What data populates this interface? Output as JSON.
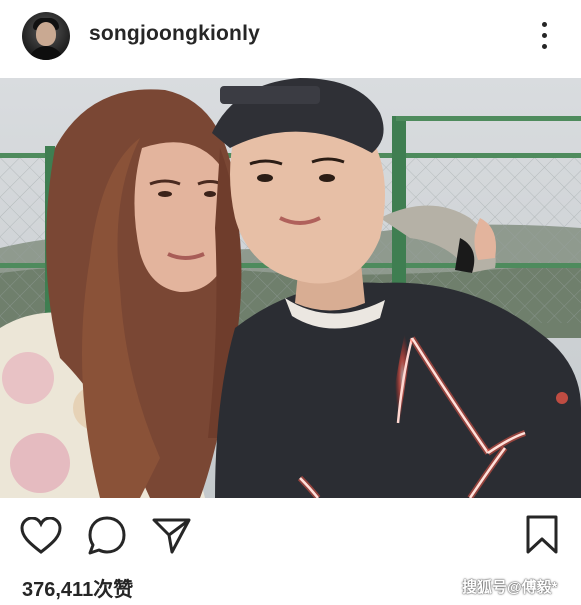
{
  "post": {
    "username": "songjoongkionly",
    "likes_text": "376,411次赞",
    "watermark": "搜狐号@傅毅*"
  },
  "icons": {
    "avatar": "profile-avatar",
    "more": "more-options-icon",
    "like": "heart-icon",
    "comment": "comment-icon",
    "share": "send-icon",
    "save": "bookmark-icon"
  },
  "colors": {
    "text": "#262626",
    "background": "#ffffff"
  }
}
